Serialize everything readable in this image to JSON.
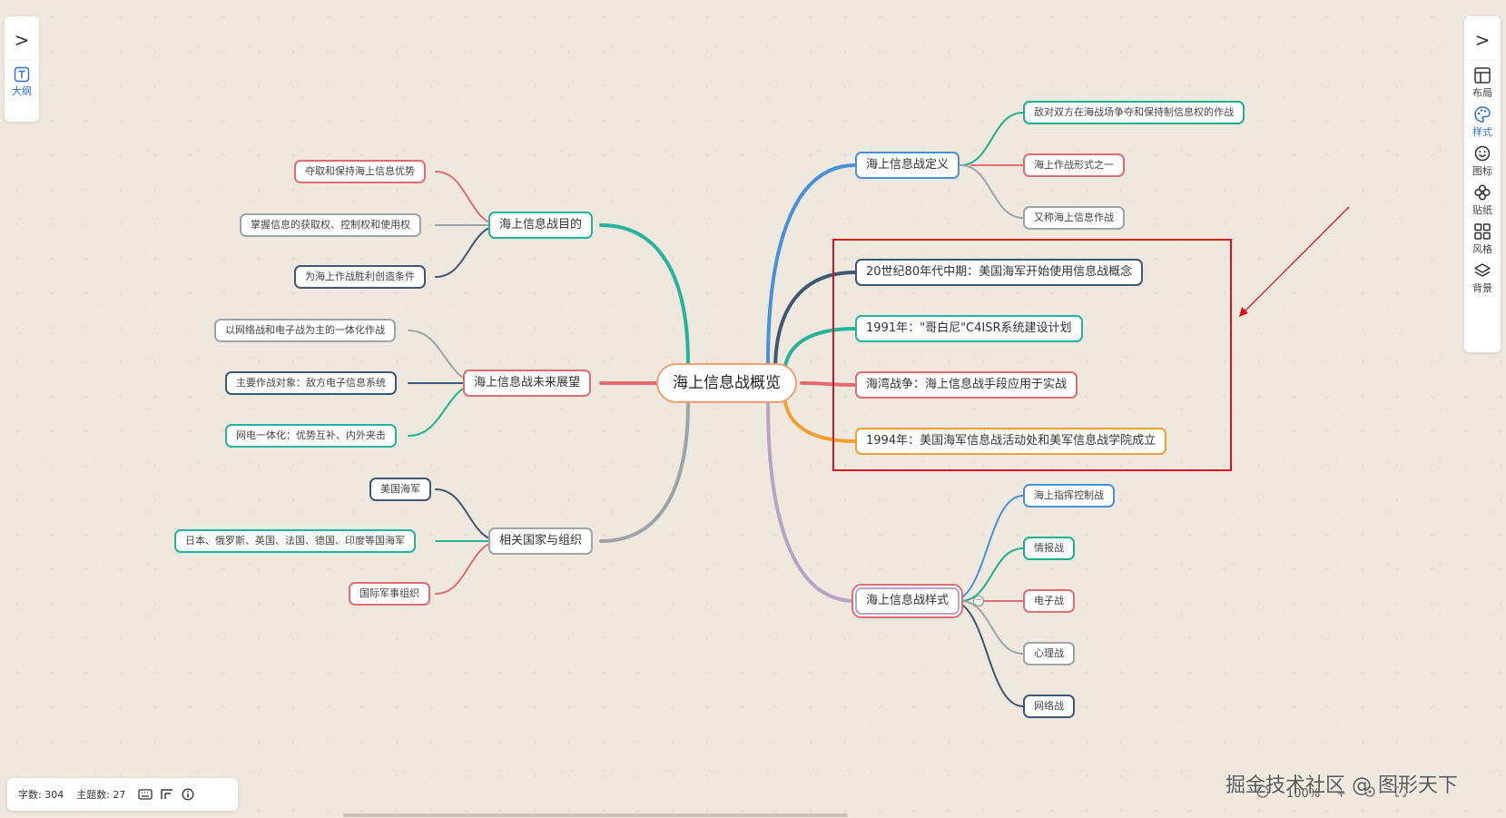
{
  "central": "海上信息战概览",
  "left": {
    "goal": {
      "title": "海上信息战目的",
      "items": [
        "夺取和保持海上信息优势",
        "掌握信息的获取权、控制权和使用权",
        "为海上作战胜利创造条件"
      ]
    },
    "future": {
      "title": "海上信息战未来展望",
      "items": [
        "以网络战和电子战为主的一体化作战",
        "主要作战对象：敌方电子信息系统",
        "网电一体化：优势互补、内外夹击"
      ]
    },
    "countries": {
      "title": "相关国家与组织",
      "items": [
        "美国海军",
        "日本、俄罗斯、英国、法国、德国、印度等国海军",
        "国际军事组织"
      ]
    }
  },
  "right": {
    "definition": {
      "title": "海上信息战定义",
      "items": [
        "敌对双方在海战场争夺和保持制信息权的作战",
        "海上作战形式之一",
        "又称海上信息作战"
      ]
    },
    "history": [
      "20世纪80年代中期：美国海军开始使用信息战概念",
      "1991年：\"哥白尼\"C4ISR系统建设计划",
      "海湾战争：海上信息战手段应用于实战",
      "1994年：美国海军信息战活动处和美军信息战学院成立"
    ],
    "styles": {
      "title": "海上信息战样式",
      "items": [
        "海上指挥控制战",
        "情报战",
        "电子战",
        "心理战",
        "网络战"
      ]
    }
  },
  "collapse_symbol": "−",
  "left_panel": {
    "expand": ">",
    "outline_label": "大纲"
  },
  "right_panel": {
    "expand": ">",
    "tools": [
      {
        "label": "布局",
        "icon": "layout-icon"
      },
      {
        "label": "样式",
        "icon": "palette-icon"
      },
      {
        "label": "图标",
        "icon": "smiley-icon"
      },
      {
        "label": "贴纸",
        "icon": "sticker-icon"
      },
      {
        "label": "风格",
        "icon": "theme-grid-icon"
      },
      {
        "label": "背景",
        "icon": "layers-icon"
      }
    ]
  },
  "status": {
    "word_count": "字数: 304",
    "topic_count": "主题数: 27"
  },
  "zoom": {
    "level": "100%",
    "plus": "+"
  },
  "watermark": "掘金技术社区 @ 图形天下",
  "colors": {
    "teal": "#26b39b",
    "blue": "#4a90d9",
    "pink": "#e26b72",
    "navy": "#3f5773",
    "gray": "#9da3a6",
    "orange": "#f0a030",
    "purple": "#b7a3c7",
    "green": "#1db089",
    "root": "#f0a070",
    "red": "#d7141b",
    "accent": "#2f6fd8"
  }
}
